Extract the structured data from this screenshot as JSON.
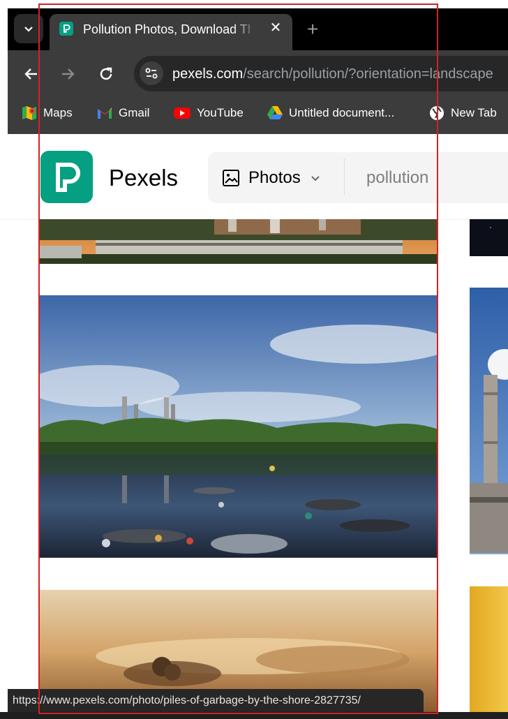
{
  "browser": {
    "tab_title": "Pollution Photos, Download The BEST Free Pollution Stock Photos & HD Images",
    "tab_close_label": "✕",
    "new_tab_label": "+",
    "url_host": "pexels.com",
    "url_path": "/search/pollution/?orientation=landscape",
    "bookmarks": [
      {
        "label": "Maps",
        "icon": "maps-icon"
      },
      {
        "label": "Gmail",
        "icon": "gmail-icon"
      },
      {
        "label": "YouTube",
        "icon": "youtube-icon"
      },
      {
        "label": "Untitled document...",
        "icon": "google-drive-icon"
      },
      {
        "label": "New Tab",
        "icon": "globe-icon"
      }
    ],
    "status_url": "https://www.pexels.com/photo/piles-of-garbage-by-the-shore-2827735/"
  },
  "site": {
    "brand_name": "Pexels",
    "search_type": "Photos",
    "search_query": "pollution"
  },
  "colors": {
    "pexels_green": "#05a081",
    "browser_dark": "#3c3c3c",
    "highlight_red": "#d32222"
  }
}
